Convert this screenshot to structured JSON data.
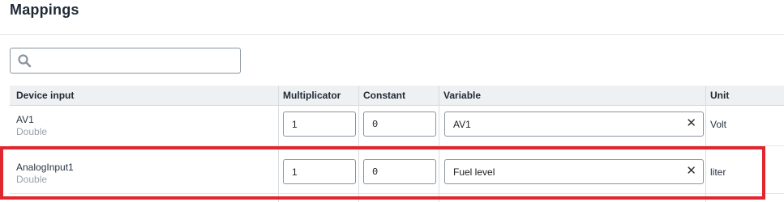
{
  "page": {
    "title": "Mappings"
  },
  "search": {
    "placeholder": "",
    "value": ""
  },
  "table": {
    "columns": [
      "Device input",
      "Multiplicator",
      "Constant",
      "Variable",
      "Unit"
    ],
    "rows": [
      {
        "input_name": "AV1",
        "input_type": "Double",
        "multiplicator": "1",
        "constant": "0",
        "variable": "AV1",
        "unit": "Volt"
      },
      {
        "input_name": "AnalogInput1",
        "input_type": "Double",
        "multiplicator": "1",
        "constant": "0",
        "variable": "Fuel level",
        "unit": "liter"
      }
    ]
  },
  "icons": {
    "search": "search-icon",
    "clear": "close-icon"
  },
  "colors": {
    "highlight": "#e0262e",
    "header_bg": "#eef0f2"
  }
}
